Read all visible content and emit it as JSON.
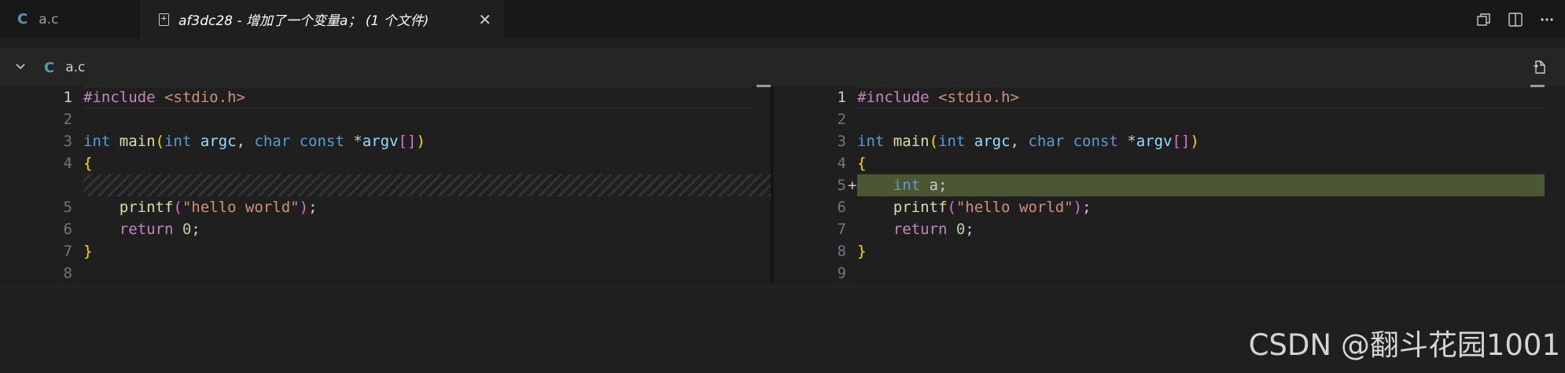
{
  "tabs": [
    {
      "icon": "c-file-icon",
      "icon_text": "C",
      "label": "a.c"
    },
    {
      "icon": "diff-icon",
      "label": "af3dc28 - 增加了一个变量a；   (1 个文件)",
      "close": "✕"
    }
  ],
  "file_header": {
    "icon_text": "C",
    "label": "a.c"
  },
  "left_pane": {
    "lines": [
      {
        "num": "1",
        "tokens": [
          {
            "t": "#include ",
            "c": "pp"
          },
          {
            "t": "<stdio.h>",
            "c": "inc"
          }
        ]
      },
      {
        "num": "2",
        "tokens": []
      },
      {
        "num": "3",
        "tokens": [
          {
            "t": "int ",
            "c": "kw"
          },
          {
            "t": "main",
            "c": "fn"
          },
          {
            "t": "(",
            "c": "brk"
          },
          {
            "t": "int ",
            "c": "kw"
          },
          {
            "t": "argc",
            "c": "prm"
          },
          {
            "t": ", ",
            "c": "plain"
          },
          {
            "t": "char ",
            "c": "kw"
          },
          {
            "t": "const ",
            "c": "kw"
          },
          {
            "t": "*",
            "c": "plain"
          },
          {
            "t": "argv",
            "c": "prm"
          },
          {
            "t": "[]",
            "c": "brk2"
          },
          {
            "t": ")",
            "c": "brk"
          }
        ]
      },
      {
        "num": "4",
        "tokens": [
          {
            "t": "{",
            "c": "brk"
          }
        ]
      },
      {
        "num": "",
        "filler": true
      },
      {
        "num": "5",
        "tokens": [
          {
            "t": "    ",
            "c": "plain"
          },
          {
            "t": "printf",
            "c": "fn"
          },
          {
            "t": "(",
            "c": "brk2"
          },
          {
            "t": "\"hello world\"",
            "c": "str"
          },
          {
            "t": ")",
            "c": "brk2"
          },
          {
            "t": ";",
            "c": "plain"
          }
        ]
      },
      {
        "num": "6",
        "tokens": [
          {
            "t": "    ",
            "c": "plain"
          },
          {
            "t": "return ",
            "c": "ctrl"
          },
          {
            "t": "0",
            "c": "num"
          },
          {
            "t": ";",
            "c": "plain"
          }
        ]
      },
      {
        "num": "7",
        "tokens": [
          {
            "t": "}",
            "c": "brk"
          }
        ]
      },
      {
        "num": "8",
        "tokens": []
      }
    ]
  },
  "right_pane": {
    "lines": [
      {
        "num": "1",
        "tokens": [
          {
            "t": "#include ",
            "c": "pp"
          },
          {
            "t": "<stdio.h>",
            "c": "inc"
          }
        ]
      },
      {
        "num": "2",
        "tokens": []
      },
      {
        "num": "3",
        "tokens": [
          {
            "t": "int ",
            "c": "kw"
          },
          {
            "t": "main",
            "c": "fn"
          },
          {
            "t": "(",
            "c": "brk"
          },
          {
            "t": "int ",
            "c": "kw"
          },
          {
            "t": "argc",
            "c": "prm"
          },
          {
            "t": ", ",
            "c": "plain"
          },
          {
            "t": "char ",
            "c": "kw"
          },
          {
            "t": "const ",
            "c": "kw"
          },
          {
            "t": "*",
            "c": "plain"
          },
          {
            "t": "argv",
            "c": "prm"
          },
          {
            "t": "[]",
            "c": "brk2"
          },
          {
            "t": ")",
            "c": "brk"
          }
        ]
      },
      {
        "num": "4",
        "tokens": [
          {
            "t": "{",
            "c": "brk"
          }
        ]
      },
      {
        "num": "5",
        "inserted": true,
        "marker": "+",
        "tokens": [
          {
            "t": "    ",
            "c": "plain"
          },
          {
            "t": "int ",
            "c": "kw"
          },
          {
            "t": "a",
            "c": "plain"
          },
          {
            "t": ";",
            "c": "plain"
          }
        ]
      },
      {
        "num": "6",
        "tokens": [
          {
            "t": "    ",
            "c": "plain"
          },
          {
            "t": "printf",
            "c": "fn"
          },
          {
            "t": "(",
            "c": "brk2"
          },
          {
            "t": "\"hello world\"",
            "c": "str"
          },
          {
            "t": ")",
            "c": "brk2"
          },
          {
            "t": ";",
            "c": "plain"
          }
        ]
      },
      {
        "num": "7",
        "tokens": [
          {
            "t": "    ",
            "c": "plain"
          },
          {
            "t": "return ",
            "c": "ctrl"
          },
          {
            "t": "0",
            "c": "num"
          },
          {
            "t": ";",
            "c": "plain"
          }
        ]
      },
      {
        "num": "8",
        "tokens": [
          {
            "t": "}",
            "c": "brk"
          }
        ]
      },
      {
        "num": "9",
        "tokens": []
      }
    ]
  },
  "colors": {
    "inserted_bg": "#4b5632",
    "accent": "#519aba"
  },
  "watermark": "CSDN @翻斗花园1001"
}
